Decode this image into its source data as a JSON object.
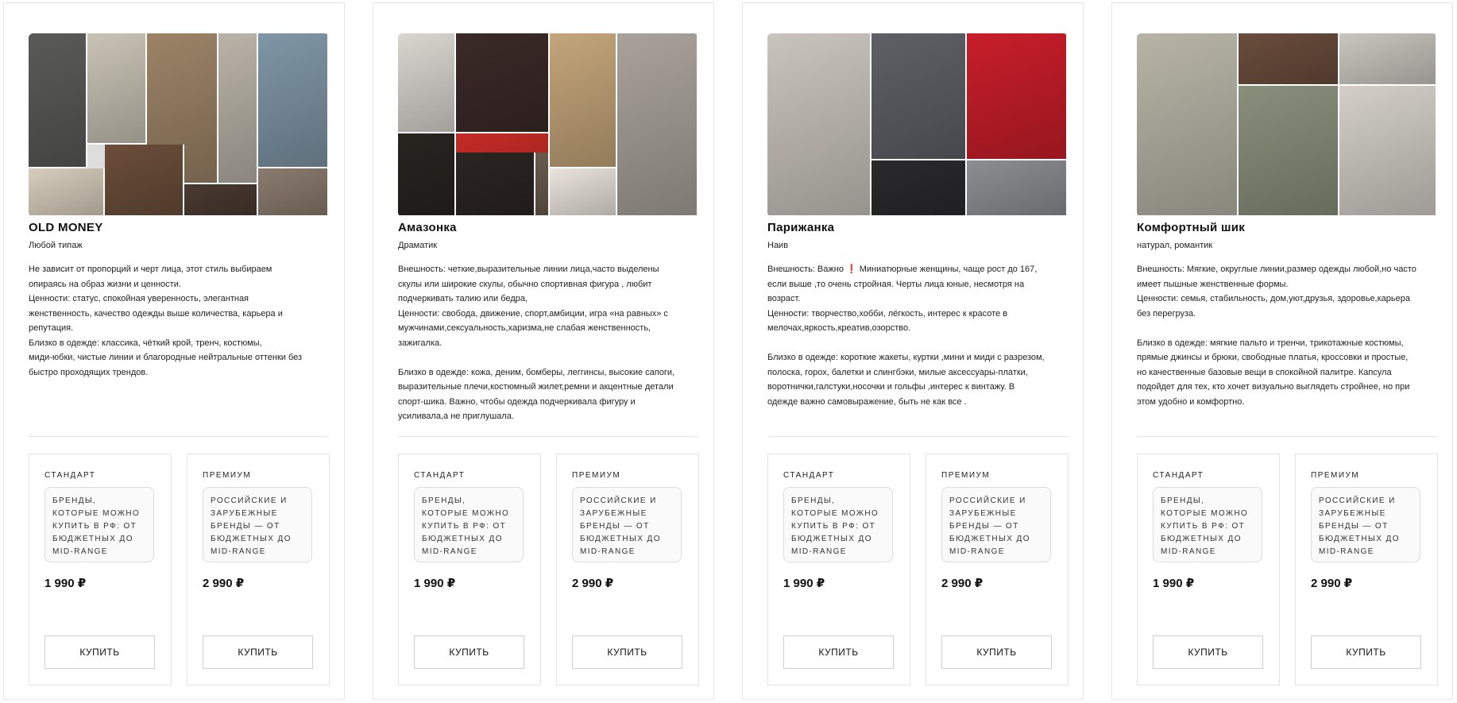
{
  "cards": [
    {
      "title": "OLD MONEY",
      "subtitle": "Любой типаж",
      "description": "Не зависит от пропорций и черт лица, этот стиль выбираем\nопираясь на образ жизни и ценности.\nЦенности: статус, спокойная уверенность, элегантная\nженственность, качество одежды выше количества, карьера и\nрепутация.\nБлизко в одежде: классика, чёткий крой, тренч, костюмы,\nмиди-юбки, чистые линии и благородные нейтральные оттенки без\nбыстро проходящих трендов.",
      "standard": {
        "name": "СТАНДАРТ",
        "desc": "Бренды, которые можно купить в РФ: от бюджетных до mid-range",
        "price": "1 990 ₽",
        "button": "Купить"
      },
      "premium": {
        "name": "ПРЕМИУМ",
        "desc": "Российские и зарубежные бренды — от бюджетных до mid-range",
        "price": "2 990 ₽",
        "button": "Купить"
      }
    },
    {
      "title": "Амазонка",
      "subtitle": "Драматик",
      "description": "Внешность: четкие,выразительные линии лица,часто выделены\nскулы или широкие скулы, обычно спортивная фигура , любит\nподчеркивать талию или бедра,\nЦенности: свобода, движение, спорт,амбиции, игра «на равных» с\nмужчинами,сексуальность,харизма,не слабая женственность,\nзажигалка.\n\nБлизко в одежде: кожа, деним, бомберы, леггинсы, высокие сапоги,\nвыразительные плечи,костюмный жилет,ремни и акцентные детали\nспорт-шика. Важно, чтобы одежда подчеркивала фигуру и\nусиливала,а не приглушала.",
      "standard": {
        "name": "СТАНДАРТ",
        "desc": "Бренды, которые можно купить в РФ: от бюджетных до mid-range",
        "price": "1 990 ₽",
        "button": "Купить"
      },
      "premium": {
        "name": "ПРЕМИУМ",
        "desc": "Российские и зарубежные бренды — от бюджетных до mid-range",
        "price": "2 990 ₽",
        "button": "Купить"
      }
    },
    {
      "title": "Парижанка",
      "subtitle": "Наив",
      "description": "Внешность: Важно ❗ Миниатюрные женщины, чаще рост до 167,\nесли выше ,то очень стройная. Черты лица юные, несмотря на\nвозраст.\nЦенности: творчество,хобби, лёгкость, интерес к красоте в\nмелочах,яркость,креатив,озорство.\n\nБлизко в одежде: короткие жакеты, куртки ,мини и миди с разрезом,\nполоска, горох, балетки и слингбэки, милые аксессуары-платки,\nворотнички,галстуки,носочки и гольфы ,интерес к винтажу. В\nодежде важно самовыражение, быть не как все .",
      "standard": {
        "name": "СТАНДАРТ",
        "desc": "Бренды, которые можно купить в РФ: от бюджетных до mid-range",
        "price": "1 990 ₽",
        "button": "Купить"
      },
      "premium": {
        "name": "ПРЕМИУМ",
        "desc": "Российские и зарубежные бренды — от бюджетных до mid-range",
        "price": "2 990 ₽",
        "button": "Купить"
      }
    },
    {
      "title": "Комфортный шик",
      "subtitle": "натурал, романтик",
      "description": "Внешность: Мягкие, округлые линии,размер одежды любой,но часто\nимеет пышные женственные формы.\nЦенности: семья, стабильность, дом,уют,друзья, здоровье,карьера\nбез перегруза.\n\nБлизко в одежде: мягкие пальто и тренчи, трикотажные костюмы,\nпрямые джинсы и брюки, свободные платья, кроссовки и простые,\nно качественные базовые вещи в спокойной палитре. Капсула\nподойдет для тех, кто хочет визуально выглядеть стройнее, но при\nэтом удобно и комфортно.",
      "standard": {
        "name": "СТАНДАРТ",
        "desc": "Бренды, которые можно купить в РФ: от бюджетных до mid-range",
        "price": "1 990 ₽",
        "button": "Купить"
      },
      "premium": {
        "name": "ПРЕМИУМ",
        "desc": "Российские и зарубежные бренды — от бюджетных до mid-range",
        "price": "2 990 ₽",
        "button": "Купить"
      }
    }
  ],
  "collages": [
    [
      {
        "color": "#5a5a58"
      },
      {
        "color": "#c9c3b6"
      },
      {
        "color": "#9c8366"
      },
      {
        "color": "#7f96a6"
      },
      {
        "color": "#6b4e3a"
      },
      {
        "color": "#d8cdbd"
      },
      {
        "color": "#4a3a31"
      },
      {
        "color": "#b9b3a8"
      },
      {
        "color": "#8a7b6e"
      }
    ],
    [
      {
        "color": "#d9d6d0"
      },
      {
        "color": "#3a2a28"
      },
      {
        "color": "#c4a57a"
      },
      {
        "color": "#a8a29a"
      },
      {
        "color": "#c42b26"
      },
      {
        "color": "#2b2522"
      },
      {
        "color": "#e9e4dc"
      },
      {
        "color": "#282420"
      },
      {
        "color": "#6b5b4e"
      }
    ],
    [
      {
        "color": "#c9c4bd"
      },
      {
        "color": "#5e6066"
      },
      {
        "color": "#c81e2a"
      },
      {
        "color": "#2a2a2c"
      },
      {
        "color": "#8c8e92"
      },
      {
        "color": "#dad6d2"
      },
      {
        "color": "#b8b2aa"
      }
    ],
    [
      {
        "color": "#b7b4a7"
      },
      {
        "color": "#6a4d3c"
      },
      {
        "color": "#c9c6bf"
      },
      {
        "color": "#8a8f7c"
      },
      {
        "color": "#d3cfc8"
      },
      {
        "color": "#545256"
      }
    ]
  ]
}
